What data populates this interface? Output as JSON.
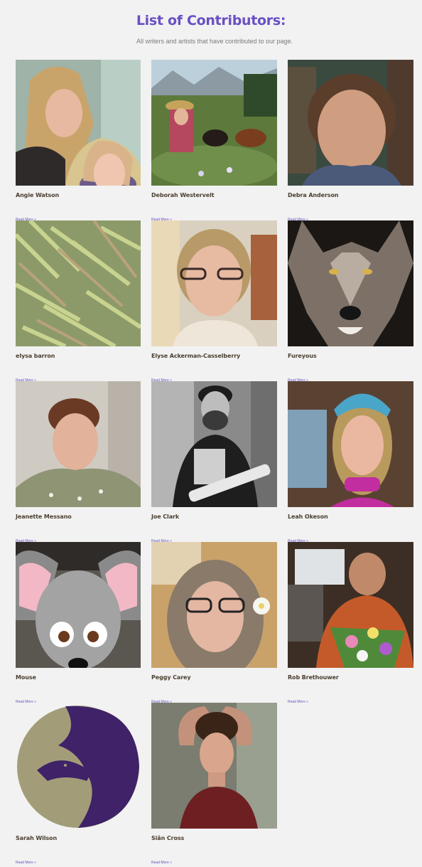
{
  "header": {
    "title": "List of Contributors:",
    "subtitle": "All writers and artists that have contributed to our page."
  },
  "read_more_label": "Read More »",
  "contributors": [
    {
      "name": "Angie Watson",
      "photo": "mother-daughter-photo"
    },
    {
      "name": "Deborah Westervelt",
      "photo": "woman-with-dogs-photo"
    },
    {
      "name": "Debra Anderson",
      "photo": "woman-portrait-photo"
    },
    {
      "name": "elysa barron",
      "photo": "grass-photo"
    },
    {
      "name": "Elyse Ackerman-Casselberry",
      "photo": "woman-glasses-photo"
    },
    {
      "name": "Fureyous",
      "photo": "wolf-photo"
    },
    {
      "name": "Jeanette Messano",
      "photo": "woman-portrait-photo"
    },
    {
      "name": "Joe Clark",
      "photo": "man-guitar-photo"
    },
    {
      "name": "Leah Okeson",
      "photo": "woman-headband-photo"
    },
    {
      "name": "Mouse",
      "photo": "cartoon-mouse-illustration"
    },
    {
      "name": "Peggy Carey",
      "photo": "woman-glasses-flower-photo"
    },
    {
      "name": "Rob Brethouwer",
      "photo": "man-flowers-photo"
    },
    {
      "name": "Sarah Wilson",
      "photo": "wolf-raven-logo"
    },
    {
      "name": "Siân Cross",
      "photo": "woman-portrait-photo"
    }
  ]
}
